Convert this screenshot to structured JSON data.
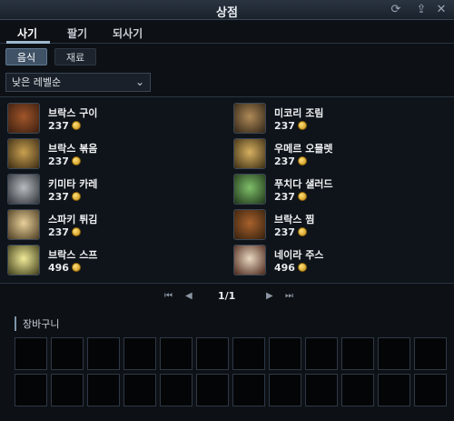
{
  "window": {
    "title": "상점"
  },
  "tabs": [
    {
      "label": "사기",
      "active": true
    },
    {
      "label": "팔기",
      "active": false
    },
    {
      "label": "되사기",
      "active": false
    }
  ],
  "subtabs": [
    {
      "label": "음식",
      "active": true
    },
    {
      "label": "재료",
      "active": false
    }
  ],
  "sort": {
    "selected": "낮은 레벨순"
  },
  "items": [
    {
      "name": "브락스 구이",
      "price": "237",
      "icon": "roasted-meat-icon"
    },
    {
      "name": "미코리 조림",
      "price": "237",
      "icon": "braised-dish-icon"
    },
    {
      "name": "브락스 볶음",
      "price": "237",
      "icon": "stir-fry-icon"
    },
    {
      "name": "우메르 오믈렛",
      "price": "237",
      "icon": "omelet-icon"
    },
    {
      "name": "키미타 카레",
      "price": "237",
      "icon": "curry-pot-icon"
    },
    {
      "name": "푸치다 샐러드",
      "price": "237",
      "icon": "salad-icon"
    },
    {
      "name": "스파키 튀김",
      "price": "237",
      "icon": "fried-food-icon"
    },
    {
      "name": "브락스 찜",
      "price": "237",
      "icon": "steamed-meat-icon"
    },
    {
      "name": "브락스 스프",
      "price": "496",
      "icon": "soup-bowl-icon"
    },
    {
      "name": "네이라 주스",
      "price": "496",
      "icon": "juice-cup-icon"
    }
  ],
  "pager": {
    "text": "1/1"
  },
  "cart": {
    "label": "장바구니"
  }
}
